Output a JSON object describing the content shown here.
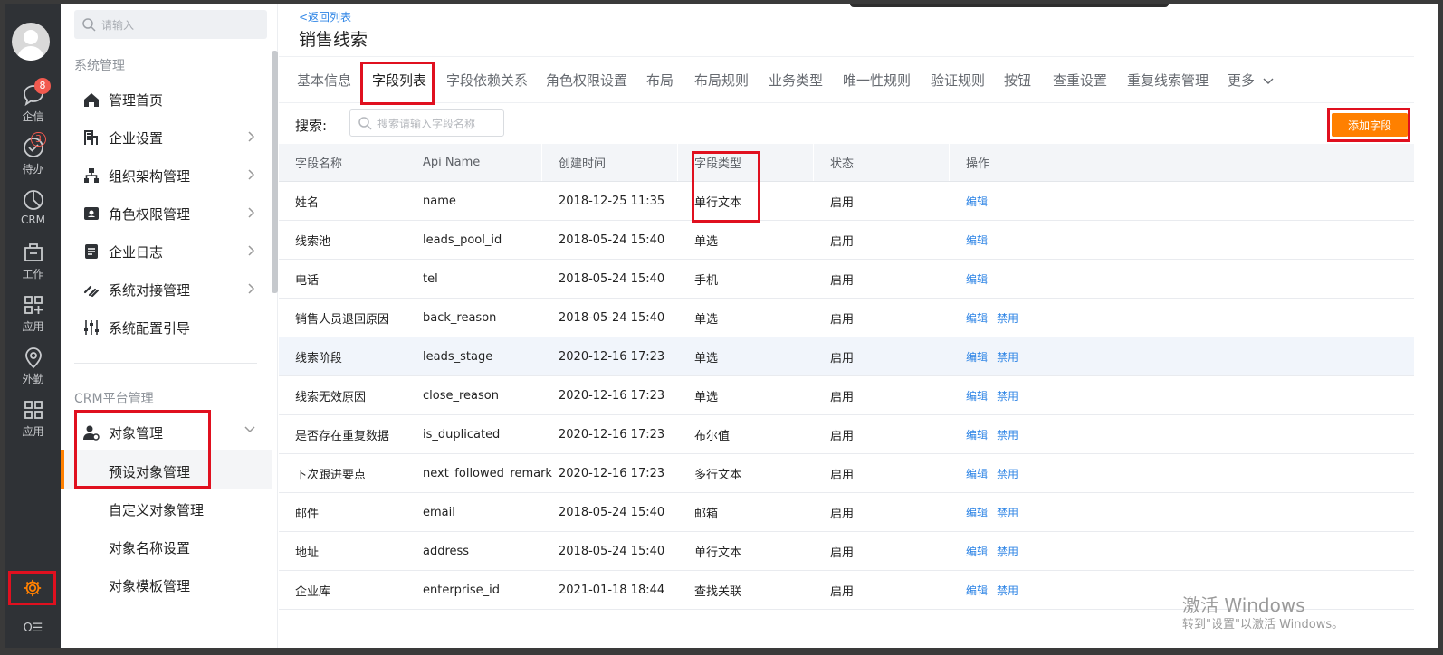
{
  "rail": {
    "items": [
      {
        "label": "企信",
        "icon": "chat-icon",
        "badge": "8"
      },
      {
        "label": "待办",
        "icon": "check-circle-icon",
        "badge": "3"
      },
      {
        "label": "CRM",
        "icon": "pie-chart-icon"
      },
      {
        "label": "工作",
        "icon": "briefcase-icon"
      },
      {
        "label": "应用",
        "icon": "apps-add-icon"
      },
      {
        "label": "外勤",
        "icon": "location-pin-icon"
      },
      {
        "label": "应用",
        "icon": "grid-icon"
      }
    ],
    "bottom_label": "Ω☰"
  },
  "sidebar": {
    "search_placeholder": "请输入",
    "group1": "系统管理",
    "items": [
      {
        "label": "管理首页",
        "icon": "home-icon"
      },
      {
        "label": "企业设置",
        "icon": "building-icon"
      },
      {
        "label": "组织架构管理",
        "icon": "org-chart-icon"
      },
      {
        "label": "角色权限管理",
        "icon": "id-card-icon"
      },
      {
        "label": "企业日志",
        "icon": "document-icon"
      },
      {
        "label": "系统对接管理",
        "icon": "link-icon"
      },
      {
        "label": "系统配置引导",
        "icon": "sliders-icon"
      }
    ],
    "group2": "CRM平台管理",
    "object_mgmt": "对象管理",
    "sub_items": [
      "预设对象管理",
      "自定义对象管理",
      "对象名称设置",
      "对象模板管理"
    ]
  },
  "main": {
    "back_link": "<返回列表",
    "title": "销售线索",
    "tabs": [
      "基本信息",
      "字段列表",
      "字段依赖关系",
      "角色权限设置",
      "布局",
      "布局规则",
      "业务类型",
      "唯一性规则",
      "验证规则",
      "按钮",
      "查重设置",
      "重复线索管理",
      "更多"
    ],
    "search_label": "搜索:",
    "search_placeholder": "搜索请输入字段名称",
    "add_button": "添加字段",
    "columns": [
      "字段名称",
      "Api Name",
      "创建时间",
      "字段类型",
      "状态",
      "操作"
    ],
    "rows": [
      {
        "name": "姓名",
        "api": "name",
        "created": "2018-12-25 11:35",
        "type": "单行文本",
        "status": "启用",
        "edit": "编辑",
        "disable": ""
      },
      {
        "name": "线索池",
        "api": "leads_pool_id",
        "created": "2018-05-24 15:40",
        "type": "单选",
        "status": "启用",
        "edit": "编辑",
        "disable": ""
      },
      {
        "name": "电话",
        "api": "tel",
        "created": "2018-05-24 15:40",
        "type": "手机",
        "status": "启用",
        "edit": "编辑",
        "disable": ""
      },
      {
        "name": "销售人员退回原因",
        "api": "back_reason",
        "created": "2018-05-24 15:40",
        "type": "单选",
        "status": "启用",
        "edit": "编辑",
        "disable": "禁用"
      },
      {
        "name": "线索阶段",
        "api": "leads_stage",
        "created": "2020-12-16 17:23",
        "type": "单选",
        "status": "启用",
        "edit": "编辑",
        "disable": "禁用"
      },
      {
        "name": "线索无效原因",
        "api": "close_reason",
        "created": "2020-12-16 17:23",
        "type": "单选",
        "status": "启用",
        "edit": "编辑",
        "disable": "禁用"
      },
      {
        "name": "是否存在重复数据",
        "api": "is_duplicated",
        "created": "2020-12-16 17:23",
        "type": "布尔值",
        "status": "启用",
        "edit": "编辑",
        "disable": "禁用"
      },
      {
        "name": "下次跟进要点",
        "api": "next_followed_remark",
        "created": "2020-12-16 17:23",
        "type": "多行文本",
        "status": "启用",
        "edit": "编辑",
        "disable": "禁用"
      },
      {
        "name": "邮件",
        "api": "email",
        "created": "2018-05-24 15:40",
        "type": "邮箱",
        "status": "启用",
        "edit": "编辑",
        "disable": "禁用"
      },
      {
        "name": "地址",
        "api": "address",
        "created": "2018-05-24 15:40",
        "type": "单行文本",
        "status": "启用",
        "edit": "编辑",
        "disable": "禁用"
      },
      {
        "name": "企业库",
        "api": "enterprise_id",
        "created": "2021-01-18 18:44",
        "type": "查找关联",
        "status": "启用",
        "edit": "编辑",
        "disable": "禁用"
      }
    ]
  },
  "watermark": {
    "line1": "激活 Windows",
    "line2": "转到\"设置\"以激活 Windows。"
  },
  "colors": {
    "accent": "#ff8000",
    "link": "#3086e6",
    "highlight_box": "#e0101f",
    "rail_bg": "#2f3236"
  }
}
